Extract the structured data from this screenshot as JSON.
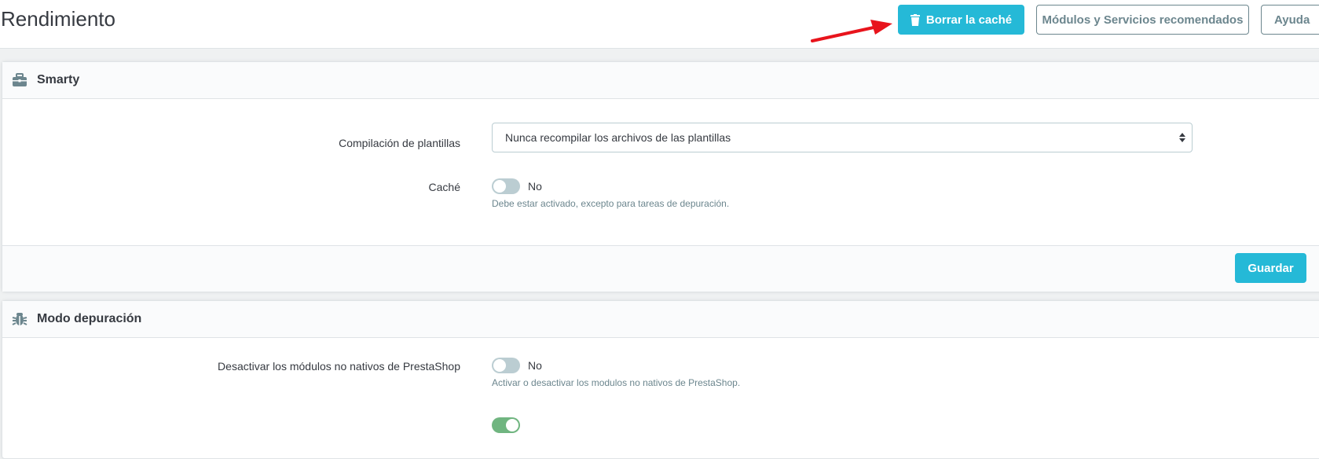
{
  "header": {
    "title": "Rendimiento",
    "clear_cache_label": "Borrar la caché",
    "modules_label": "Módulos y Servicios recomendados",
    "help_label": "Ayuda"
  },
  "smarty": {
    "heading": "Smarty",
    "compilation_label": "Compilación de plantillas",
    "compilation_value": "Nunca recompilar los archivos de las plantillas",
    "cache_label": "Caché",
    "cache_state": "No",
    "cache_help": "Debe estar activado, excepto para tareas de depuración.",
    "save_label": "Guardar"
  },
  "debug": {
    "heading": "Modo depuración",
    "non_native_label": "Desactivar los módulos no nativos de PrestaShop",
    "non_native_state": "No",
    "non_native_help": "Activar o desactivar los modulos no nativos de PrestaShop."
  },
  "colors": {
    "primary": "#25b9d7",
    "arrow": "#e8141c",
    "switch_off": "#bbcdd2",
    "switch_on": "#70b580"
  },
  "icons": {
    "clear_cache": "trash-icon",
    "smarty": "briefcase-icon",
    "debug": "bug-icon",
    "select": "sort-caret-icon"
  }
}
